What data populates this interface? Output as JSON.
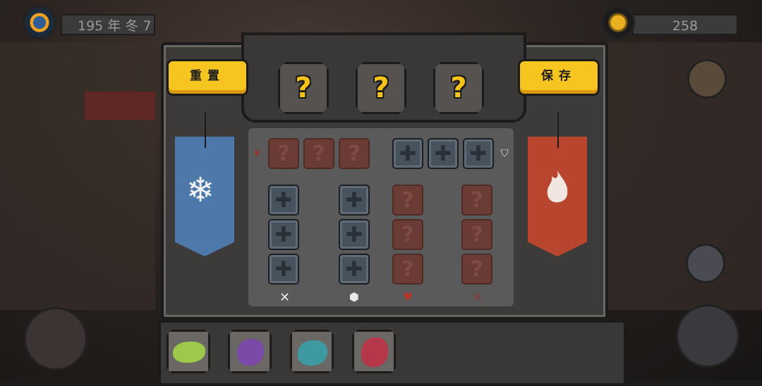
{
  "top_left": {
    "date": "195 年 冬 7"
  },
  "top_right": {
    "coins": "258"
  },
  "buttons": {
    "reset": "重置",
    "save": "保存"
  },
  "slots": [
    {
      "symbol": "?"
    },
    {
      "symbol": "?"
    },
    {
      "symbol": "?"
    }
  ],
  "tile_glyphs": {
    "locked": "?",
    "slot": "✚"
  },
  "column_icons": {
    "sword": "✕",
    "shield": "⬢",
    "heart": "♥",
    "cross": "✕"
  },
  "row_icons": {
    "flame": "♦",
    "bucket": "⛉"
  },
  "banners": {
    "left": {
      "color": "#4d79aa",
      "emblem": "❄"
    },
    "right": {
      "color": "#b8452d",
      "emblem": "flame"
    }
  },
  "colors": {
    "accent_yellow": "#f7c520",
    "red_tile": "#6b3c35",
    "blue_tile": "#48525c"
  }
}
